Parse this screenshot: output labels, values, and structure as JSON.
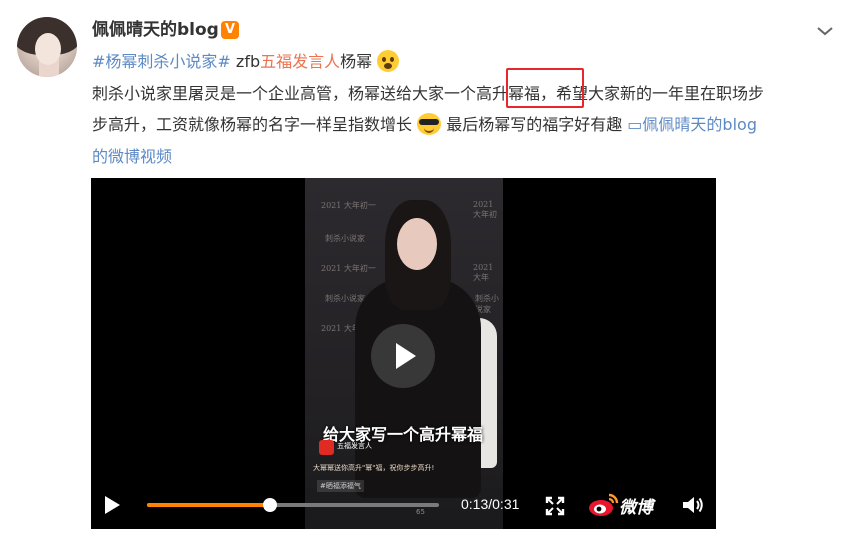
{
  "post": {
    "username": "佩佩晴天的blog",
    "verified_badge": "V",
    "line1": {
      "topic": "#杨幂刺杀小说家#",
      "mid": " zfb",
      "link": "五福发言人",
      "tail": "杨幂"
    },
    "line2": "刺杀小说家里屠灵是一个企业高管，杨幂送给大家一个高升幂福，希望大家新的一年里在职场步",
    "line3_a": "步高升，工资就像杨幂的名字一样呈指数增长",
    "line3_b": " 最后杨幂写的福字好有趣 ",
    "video_link_icon": "▭",
    "video_link_text": "佩佩晴天的blog",
    "line4": "的微博视频"
  },
  "video": {
    "bg_texts": [
      "2021 大年初一",
      "2021 大年初",
      "刺杀小说家",
      "2021 大年初一",
      "2021 大年",
      "刺杀小说家",
      "2021 大年初一",
      "刺杀小说家"
    ],
    "caption": "给大家写一个高升幂福",
    "label": "五福发言人",
    "subcaption": "大幂幂送你高升\"幂\"福，祝你步步高升!",
    "subtag": "#晒福添福气",
    "likes": "65",
    "time_display": "0:13/0:31",
    "progress": 0.42,
    "brand_text": "微博"
  },
  "colors": {
    "topic": "#5d8ac4",
    "link": "#eb7350",
    "progress": "#ff8200",
    "highlight_box": "#e8272c"
  },
  "icons": [
    "chevron-down-icon",
    "play-icon",
    "fullscreen-icon",
    "weibo-logo-icon",
    "volume-icon"
  ]
}
